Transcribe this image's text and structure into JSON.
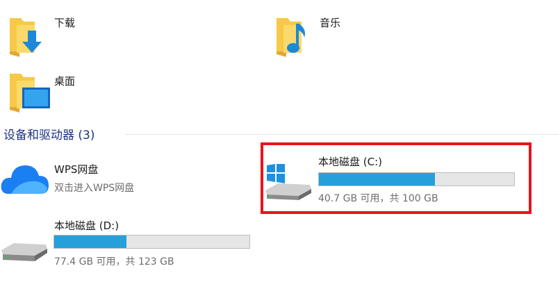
{
  "folders": [
    {
      "name": "下载",
      "icon": "downloads-folder-icon"
    },
    {
      "name": "音乐",
      "icon": "music-folder-icon"
    },
    {
      "name": "桌面",
      "icon": "desktop-folder-icon"
    }
  ],
  "devices_section": {
    "title": "设备和驱动器 (3)"
  },
  "wps": {
    "name": "WPS网盘",
    "subtitle": "双击进入WPS网盘",
    "icon": "cloud-icon"
  },
  "drives": [
    {
      "name": "本地磁盘 (C:)",
      "free_text": "40.7 GB 可用，共 100 GB",
      "used_fraction": 0.593,
      "icon": "windows-drive-icon",
      "highlighted": true
    },
    {
      "name": "本地磁盘 (D:)",
      "free_text": "77.4 GB 可用，共 123 GB",
      "used_fraction": 0.371,
      "icon": "hard-drive-icon",
      "highlighted": false
    }
  ],
  "colors": {
    "usage_bar": "#26a0da",
    "highlight": "#e8141b",
    "section_title": "#1e3287",
    "folder": "#f7c948"
  }
}
